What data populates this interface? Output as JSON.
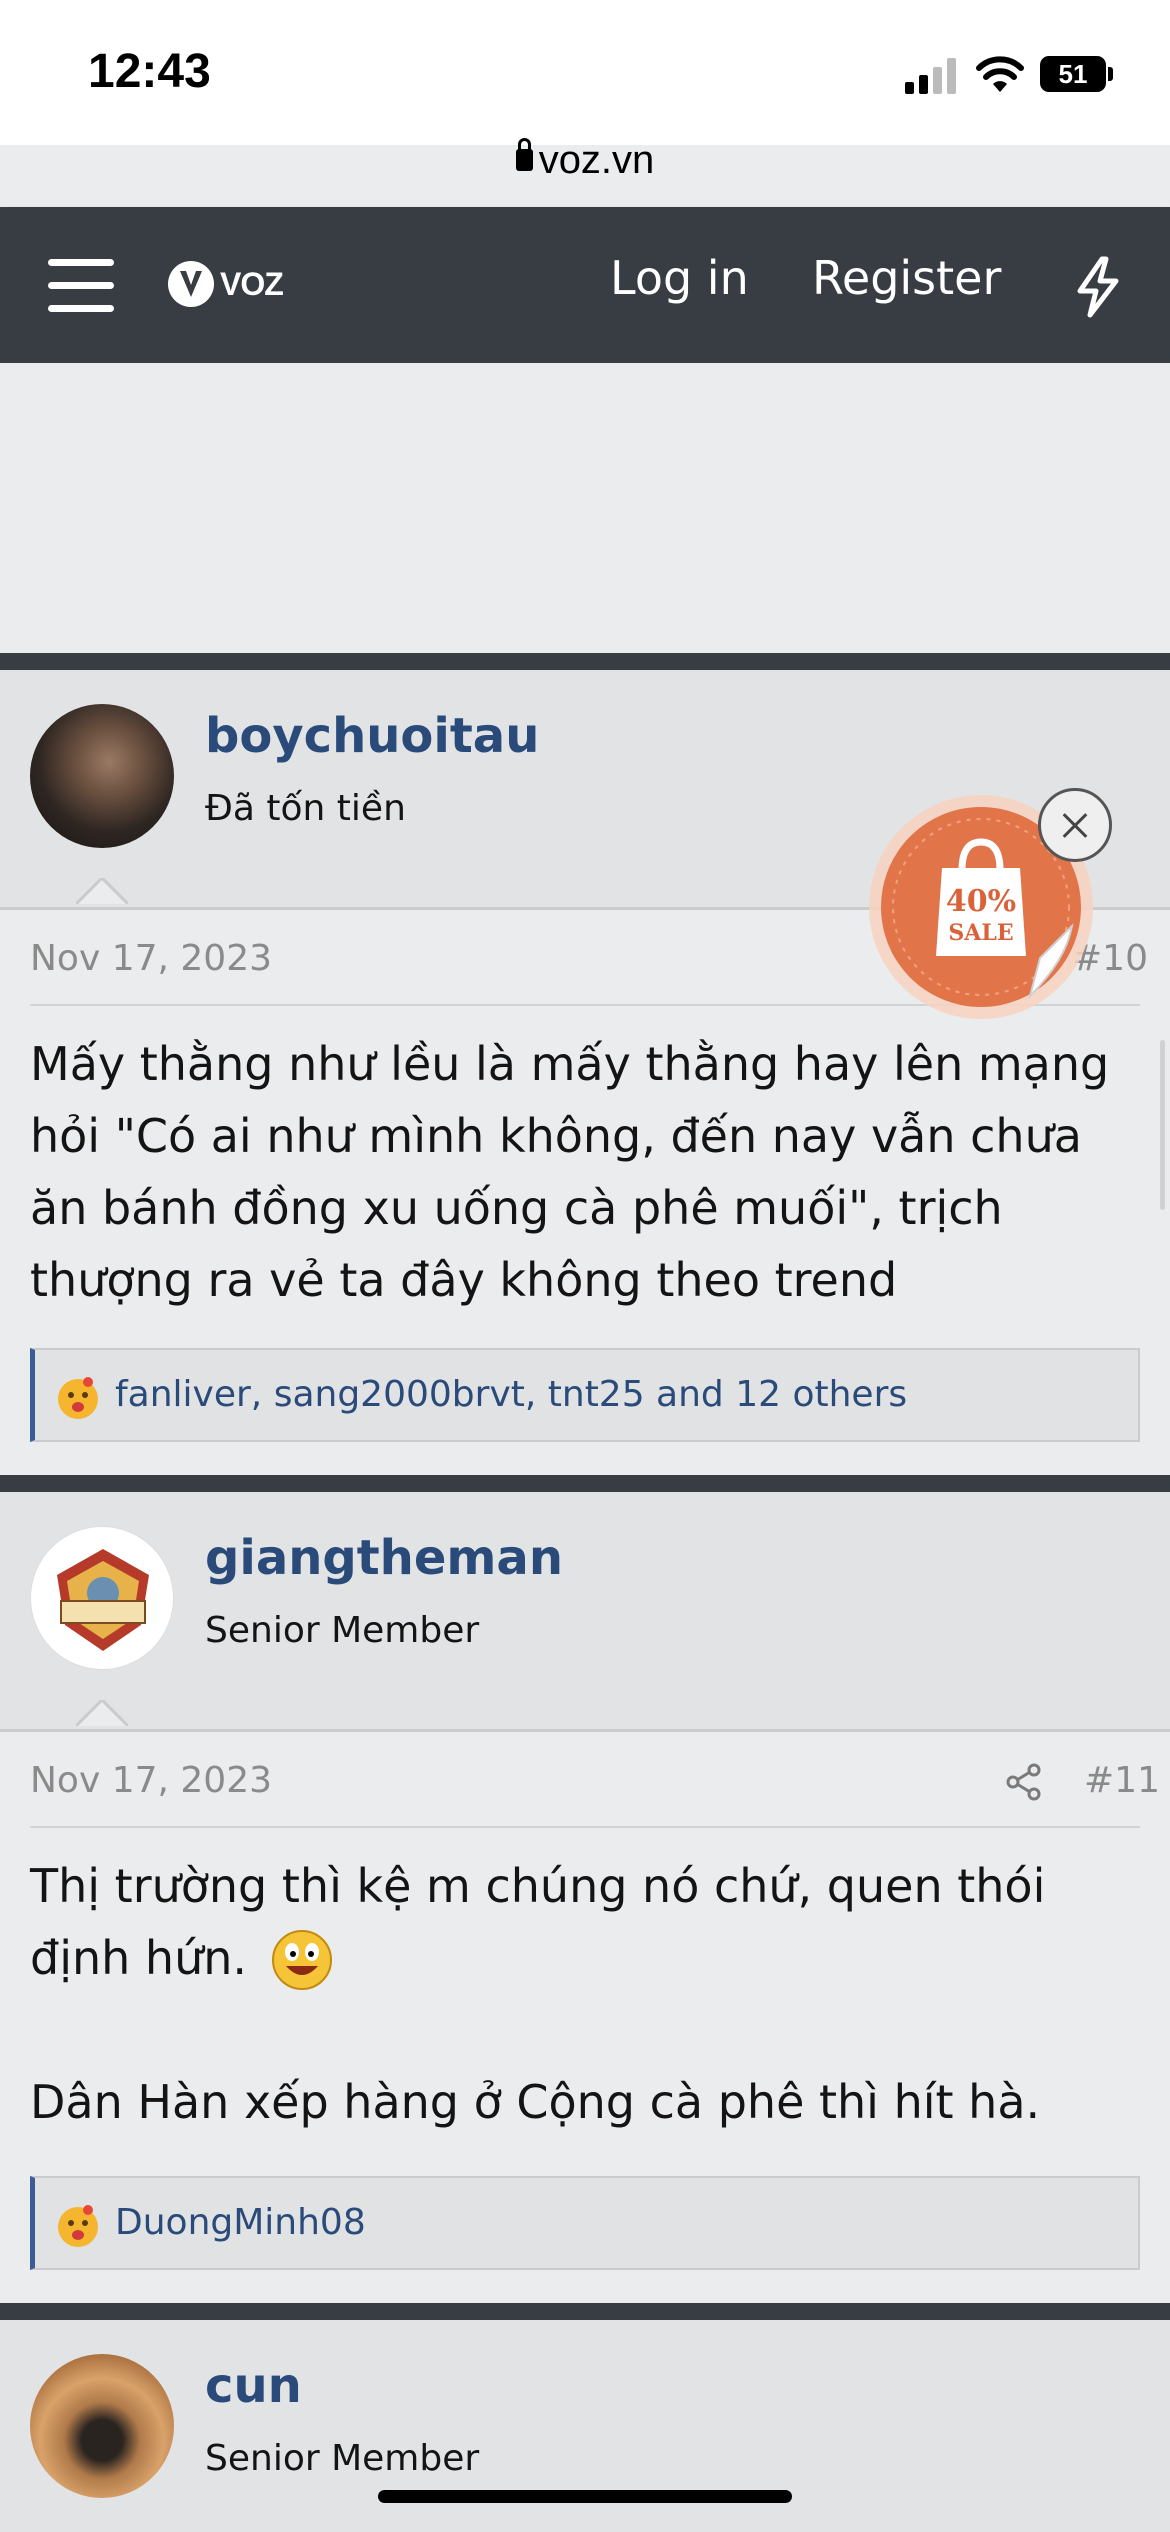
{
  "status_bar": {
    "time": "12:43",
    "battery": "51"
  },
  "browser": {
    "url": "voz.vn"
  },
  "navbar": {
    "logo_text": "VOZ",
    "login_label": "Log in",
    "register_label": "Register"
  },
  "posts": [
    {
      "username": "boychuoitau",
      "user_title": "Đã tốn tiền",
      "date": "Nov 17, 2023",
      "number": "#10",
      "body_lines": [
        "Mấy thằng như lều là mấy thằng hay lên mạng",
        "hỏi \"Có ai như mình không, đến nay vẫn chưa",
        "ăn bánh đồng xu uống cà phê muối\", trịch",
        "thượng ra vẻ ta đây không theo trend"
      ],
      "reactions": "fanliver, sang2000brvt, tnt25 and 12 others"
    },
    {
      "username": "giangtheman",
      "user_title": "Senior Member",
      "date": "Nov 17, 2023",
      "number": "#11",
      "body_lines": [
        "Thị trường thì kệ m chúng nó chứ, quen thói",
        "định hứn.",
        "",
        "Dân Hàn xếp hàng ở Cộng cà phê thì hít hà."
      ],
      "reactions": "DuongMinh08"
    },
    {
      "username": "cun",
      "user_title": "Senior Member"
    }
  ],
  "ad_badge": {
    "percent": "40%",
    "label": "SALE"
  },
  "icons": [
    "lock-icon",
    "menu-icon",
    "voz-logo",
    "bolt-icon",
    "close-icon",
    "share-icon",
    "reaction-emoji",
    "smiley-emoji"
  ],
  "colors": {
    "navbar": "#373d43",
    "link": "#2a4a7a",
    "sale": "#e2744a"
  }
}
